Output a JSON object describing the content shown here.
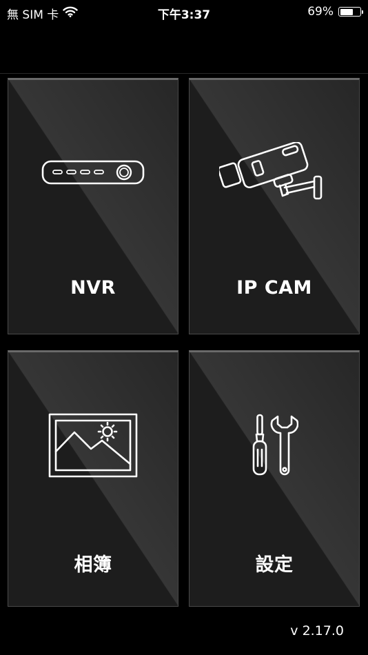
{
  "status_bar": {
    "carrier": "無 SIM 卡",
    "time": "下午3:37",
    "battery_percent": "69%",
    "battery_level": 0.69,
    "icons": [
      "wifi-icon",
      "battery-icon"
    ]
  },
  "tiles": [
    {
      "label": "NVR",
      "icon": "nvr-recorder-icon"
    },
    {
      "label": "IP CAM",
      "icon": "security-camera-icon"
    },
    {
      "label": "相簿",
      "icon": "photo-album-icon"
    },
    {
      "label": "設定",
      "icon": "tools-settings-icon"
    }
  ],
  "version": "v 2.17.0",
  "colors": {
    "background": "#000000",
    "tile": "#1d1d1d",
    "foreground": "#ffffff"
  }
}
